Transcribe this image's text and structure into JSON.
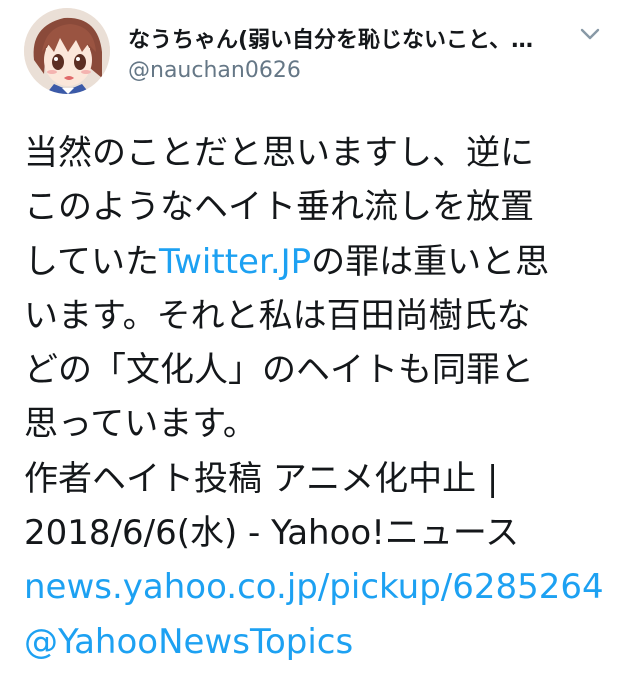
{
  "user": {
    "display_name": "なうちゃん(弱い自分を恥じないこと、…",
    "handle": "@nauchan0626"
  },
  "tweet": {
    "line1": "当然のことだと思いますし、逆に",
    "line2": "このようなヘイト垂れ流しを放置",
    "line3_before": "していた",
    "line3_link": "Twitter.JP",
    "line3_after": "の罪は重いと思",
    "line4": "います。それと私は百田尚樹氏な",
    "line5": "どの「文化人」のヘイトも同罪と",
    "line6": "思っています。",
    "line7": "作者ヘイト投稿 アニメ化中止 |",
    "line8": "2018/6/6(水) - Yahoo!ニュース",
    "url": "news.yahoo.co.jp/pickup/6285264",
    "mention": "@YahooNewsTopics"
  },
  "icons": {
    "avatar": "anime-avatar",
    "menu": "chevron-down-icon"
  },
  "colors": {
    "text": "#14171a",
    "secondary": "#657786",
    "link": "#1da1f2"
  }
}
